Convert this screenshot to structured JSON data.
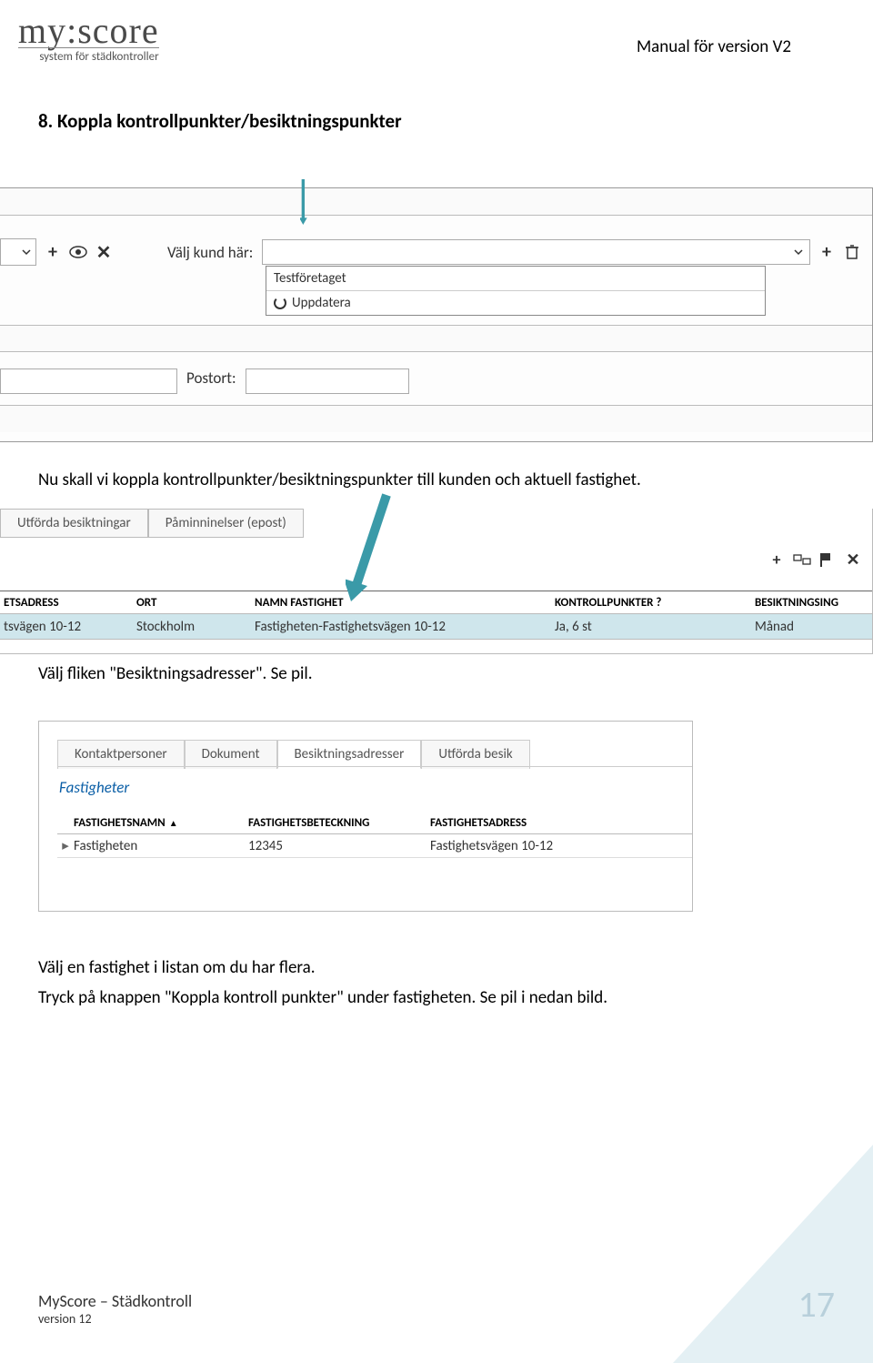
{
  "header": {
    "logo_main": "my:score",
    "logo_sub": "system för städkontroller",
    "right": "Manual för version V2"
  },
  "section": {
    "heading": "8.  Koppla kontrollpunkter/besiktningspunkter",
    "p1": "Nu skall vi koppla kontrollpunkter/besiktningspunkter till kunden och aktuell fastighet.",
    "p2": "Välj fliken \"Besiktningsadresser\". Se pil.",
    "p3": "Välj en fastighet i listan om du har flera.",
    "p4": "Tryck på knappen \"Koppla kontroll punkter\" under fastigheten. Se pil i nedan bild."
  },
  "shot1": {
    "kund_label": "Välj kund här:",
    "dd_item": "Testföretaget",
    "dd_refresh": "Uppdatera",
    "postort_label": "Postort:",
    "icons": {
      "chevron": "chevron-down-icon",
      "plus": "plus-icon",
      "eye": "eye-icon",
      "close": "close-icon",
      "trash": "trash-icon"
    }
  },
  "shot2": {
    "tabs": [
      "Utförda besiktningar",
      "Påminninelser (epost)"
    ],
    "headers": [
      "ETSADRESS",
      "ORT",
      "NAMN FASTIGHET",
      "KONTROLLPUNKTER ?",
      "BESIKTNINGSING"
    ],
    "row": [
      "tsvägen 10-12",
      "Stockholm",
      "Fastigheten-Fastighetsvägen 10-12",
      "Ja, 6 st",
      "Månad"
    ]
  },
  "shot3": {
    "tabs": [
      "Kontaktpersoner",
      "Dokument",
      "Besiktningsadresser",
      "Utförda besik"
    ],
    "active_tab_index": 2,
    "heading": "Fastigheter",
    "headers": [
      "FASTIGHETSNAMN",
      "FASTIGHETSBETECKNING",
      "FASTIGHETSADRESS"
    ],
    "row": [
      "Fastigheten",
      "12345",
      "Fastighetsvägen 10-12"
    ]
  },
  "footer": {
    "title": "MyScore – Städkontroll",
    "version": "version 12",
    "page": "17"
  }
}
